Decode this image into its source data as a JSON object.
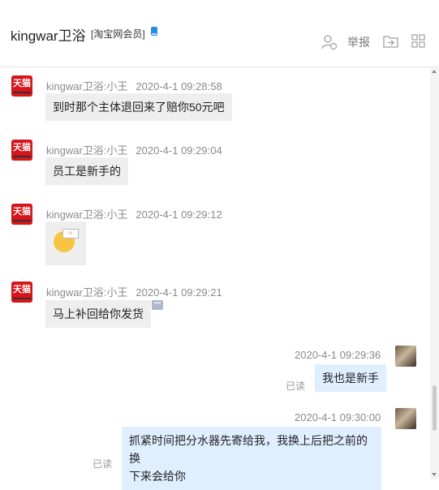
{
  "header": {
    "title": "kingwar卫浴",
    "tag": "[淘宝网会员]",
    "report_label": "举报",
    "icons": [
      "add-contact-icon",
      "report",
      "forward-icon",
      "apps-grid-icon"
    ]
  },
  "messages": [
    {
      "sender": "kingwar卫浴:小王",
      "time": "2020-4-1 09:28:58",
      "text": "到时那个主体退回来了赔你50元吧",
      "avatar": "天猫"
    },
    {
      "sender": "kingwar卫浴:小王",
      "time": "2020-4-1 09:29:04",
      "text": "员工是新手的",
      "avatar": "天猫"
    },
    {
      "sender": "kingwar卫浴:小王",
      "time": "2020-4-1 09:29:12",
      "sticker": "emoji-sticker",
      "avatar": "天猫"
    },
    {
      "sender": "kingwar卫浴:小王",
      "time": "2020-4-1 09:29:21",
      "text": "马上补回给你发货",
      "avatar": "天猫"
    }
  ],
  "my_messages": [
    {
      "time": "2020-4-1 09:29:36",
      "text": "我也是新手",
      "status": "已读"
    },
    {
      "time": "2020-4-1 09:30:00",
      "text_line1": "抓紧时间把分水器先寄给我，我换上后把之前的换",
      "text_line2": "下来会给你",
      "status": "已读"
    }
  ]
}
